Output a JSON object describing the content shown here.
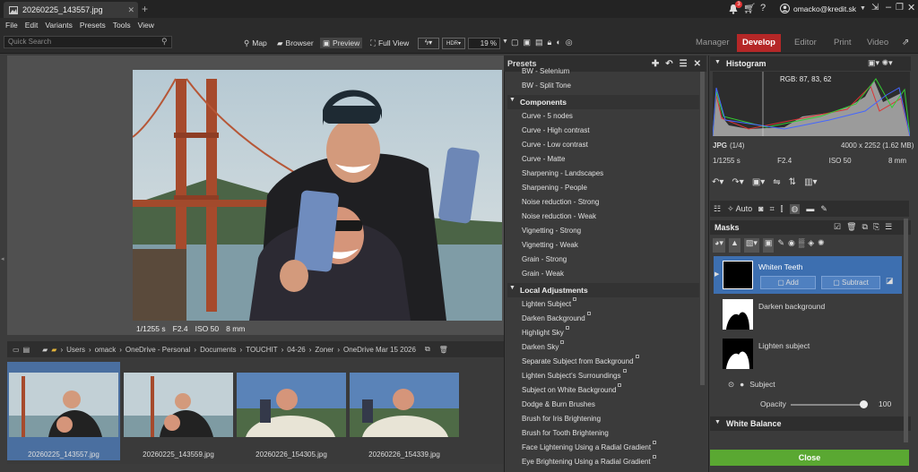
{
  "title_tab": "20260225_143557.jpg",
  "user": {
    "email": "omacko@kredit.sk",
    "badge": "3"
  },
  "menu": [
    "File",
    "Edit",
    "Variants",
    "Presets",
    "Tools",
    "View"
  ],
  "toolbar": {
    "search_placeholder": "Quick Search",
    "map": "Map",
    "browser": "Browser",
    "preview": "Preview",
    "fullview": "Full View",
    "zoom": "19 %"
  },
  "modules": [
    {
      "label": "Manager"
    },
    {
      "label": "Develop"
    },
    {
      "label": "Editor"
    },
    {
      "label": "Print"
    },
    {
      "label": "Video"
    }
  ],
  "viewer_meta": {
    "shutter": "1/1255 s",
    "aperture": "F2.4",
    "iso": "ISO 50",
    "focal": "8 mm"
  },
  "path": [
    "Users",
    "omack",
    "OneDrive - Personal",
    "Documents",
    "TOUCHIT",
    "04-26",
    "Zoner",
    "OneDrive Mar 15 2026"
  ],
  "thumbs": [
    {
      "name": "20260225_143557.jpg"
    },
    {
      "name": "20260225_143559.jpg"
    },
    {
      "name": "20260226_154305.jpg"
    },
    {
      "name": "20260226_154339.jpg"
    }
  ],
  "presets": {
    "title": "Presets",
    "top_items": [
      "BW - Selenium",
      "BW - Split Tone"
    ],
    "components_title": "Components",
    "components": [
      "Curve - 5 nodes",
      "Curve - High contrast",
      "Curve - Low contrast",
      "Curve - Matte",
      "Sharpening - Landscapes",
      "Sharpening - People",
      "Noise reduction - Strong",
      "Noise reduction - Weak",
      "Vignetting - Strong",
      "Vignetting - Weak",
      "Grain - Strong",
      "Grain - Weak"
    ],
    "local_title": "Local Adjustments",
    "local": [
      "Lighten Subject",
      "Darken Background",
      "Highlight Sky",
      "Darken Sky",
      "Separate Subject from Background",
      "Lighten Subject's Surroundings",
      "Subject on White Background",
      "Dodge & Burn Brushes",
      "Brush for Iris Brightening",
      "Brush for Tooth Brightening",
      "Face Lightening Using a Radial Gradient",
      "Eye Brightening Using a Radial Gradient"
    ]
  },
  "histogram": {
    "title": "Histogram",
    "rgb": "RGB:  87,  83,  62",
    "format": "JPG",
    "index": "(1/4)",
    "dims": "4000 x 2252 (1.62 MB)",
    "shutter": "1/1255 s",
    "aperture": "F2.4",
    "iso": "ISO 50",
    "focal": "8 mm"
  },
  "tools": {
    "auto": "Auto"
  },
  "masks": {
    "title": "Masks",
    "items": [
      {
        "name": "Whiten Teeth"
      },
      {
        "name": "Darken background"
      },
      {
        "name": "Lighten subject"
      }
    ],
    "add": "Add",
    "subtract": "Subtract",
    "subject": "Subject",
    "opacity_label": "Opacity",
    "opacity_value": "100",
    "opacity": 1.0
  },
  "white_balance": "White Balance",
  "close": "Close"
}
